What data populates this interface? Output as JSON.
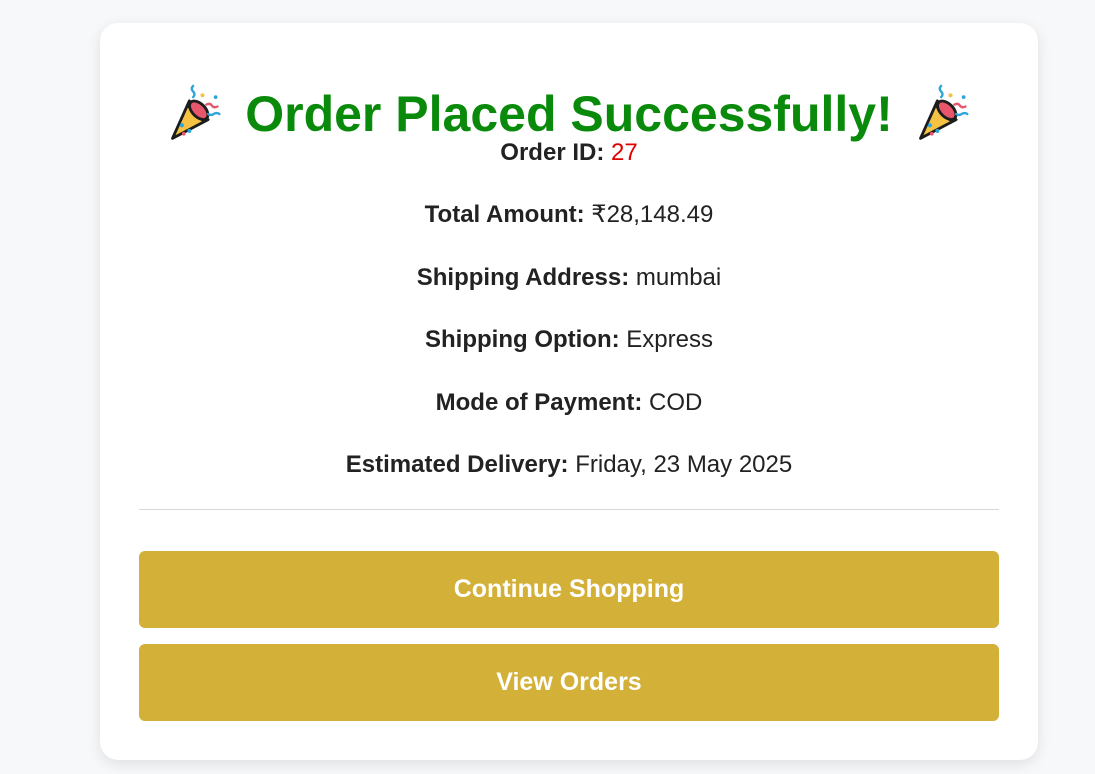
{
  "header": {
    "title": "Order Placed Successfully!",
    "icon_left": "party-popper-icon",
    "icon_right": "party-popper-icon",
    "title_color": "#0a8a0a"
  },
  "order": {
    "id_label": "Order ID:",
    "id_value": "27",
    "id_color": "#e00000",
    "total_label": "Total Amount:",
    "total_value": "₹28,148.49",
    "address_label": "Shipping Address:",
    "address_value": "mumbai",
    "option_label": "Shipping Option:",
    "option_value": "Express",
    "payment_label": "Mode of Payment:",
    "payment_value": "COD",
    "delivery_label": "Estimated Delivery:",
    "delivery_value": "Friday, 23 May 2025"
  },
  "actions": {
    "continue_label": "Continue Shopping",
    "orders_label": "View Orders",
    "button_color": "#d3b038"
  }
}
